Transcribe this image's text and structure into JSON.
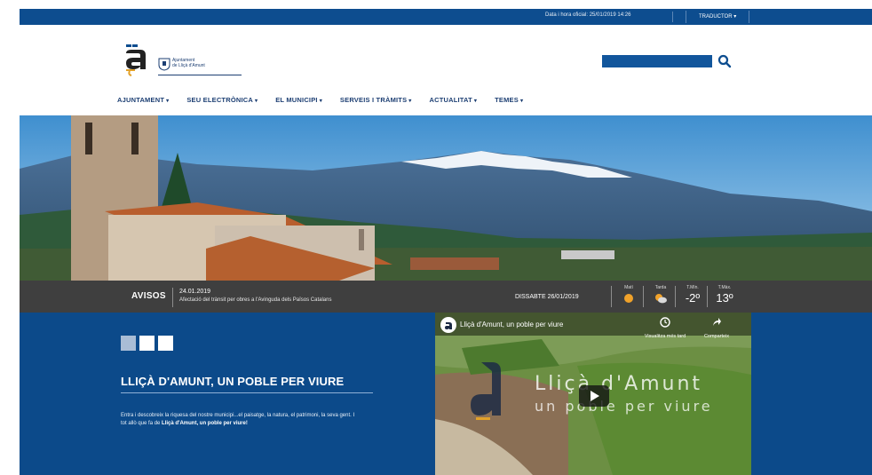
{
  "topbar": {
    "clock": "Data i hora oficial: 25/01/2019 14:26",
    "translator": "TRADUCTOR",
    "translator_caret": "▾"
  },
  "header": {
    "logo_line1": "Ajuntament",
    "logo_line2": "de Lliçà d'Amunt",
    "search_placeholder": "",
    "search_icon": "search-icon"
  },
  "nav": [
    {
      "label": "AJUNTAMENT"
    },
    {
      "label": "SEU ELECTRÒNICA"
    },
    {
      "label": "EL MUNICIPI"
    },
    {
      "label": "SERVEIS I TRÀMITS"
    },
    {
      "label": "ACTUALITAT"
    },
    {
      "label": "TEMES"
    }
  ],
  "nav_caret": "▾",
  "infobar": {
    "avisos": "AVISOS",
    "notice_date": "24.01.2019",
    "notice_text": "Afectació del trànsit per obres a l'Avinguda dels Països Catalans",
    "today": "DISSABTE 26/01/2019",
    "weather": [
      {
        "label": "Matí",
        "icon": "sun-icon"
      },
      {
        "label": "Tarda",
        "icon": "partly-cloudy-icon"
      },
      {
        "label": "T.Mín.",
        "value": "-2º"
      },
      {
        "label": "T.Màx.",
        "value": "13º"
      }
    ]
  },
  "bottom": {
    "squares": [
      "#a9bdd6",
      "#ffffff",
      "#ffffff"
    ],
    "headline": "LLIÇÀ D'AMUNT, UN POBLE PER VIURE",
    "lead_text": "Entra i descobreix la riquesa del nostre municipi...el paisatge, la natura, el patrimoni, la seva gent. I tot allò que fa de ",
    "lead_strong": "Lliçà d'Amunt, un poble per viure!"
  },
  "video": {
    "channel_title": "Lliçà d'Amunt, un poble per viure",
    "watch_later": "Visualitza més tard",
    "share": "Comparteix",
    "overlay_title": "Lliçà d'Amunt",
    "overlay_subtitle": "un poble per viure"
  },
  "colors": {
    "brand_blue": "#0d4d8f",
    "section_blue": "#0c4a8a",
    "nav_text": "#1d3f73",
    "infobar": "#3f3f3f"
  }
}
